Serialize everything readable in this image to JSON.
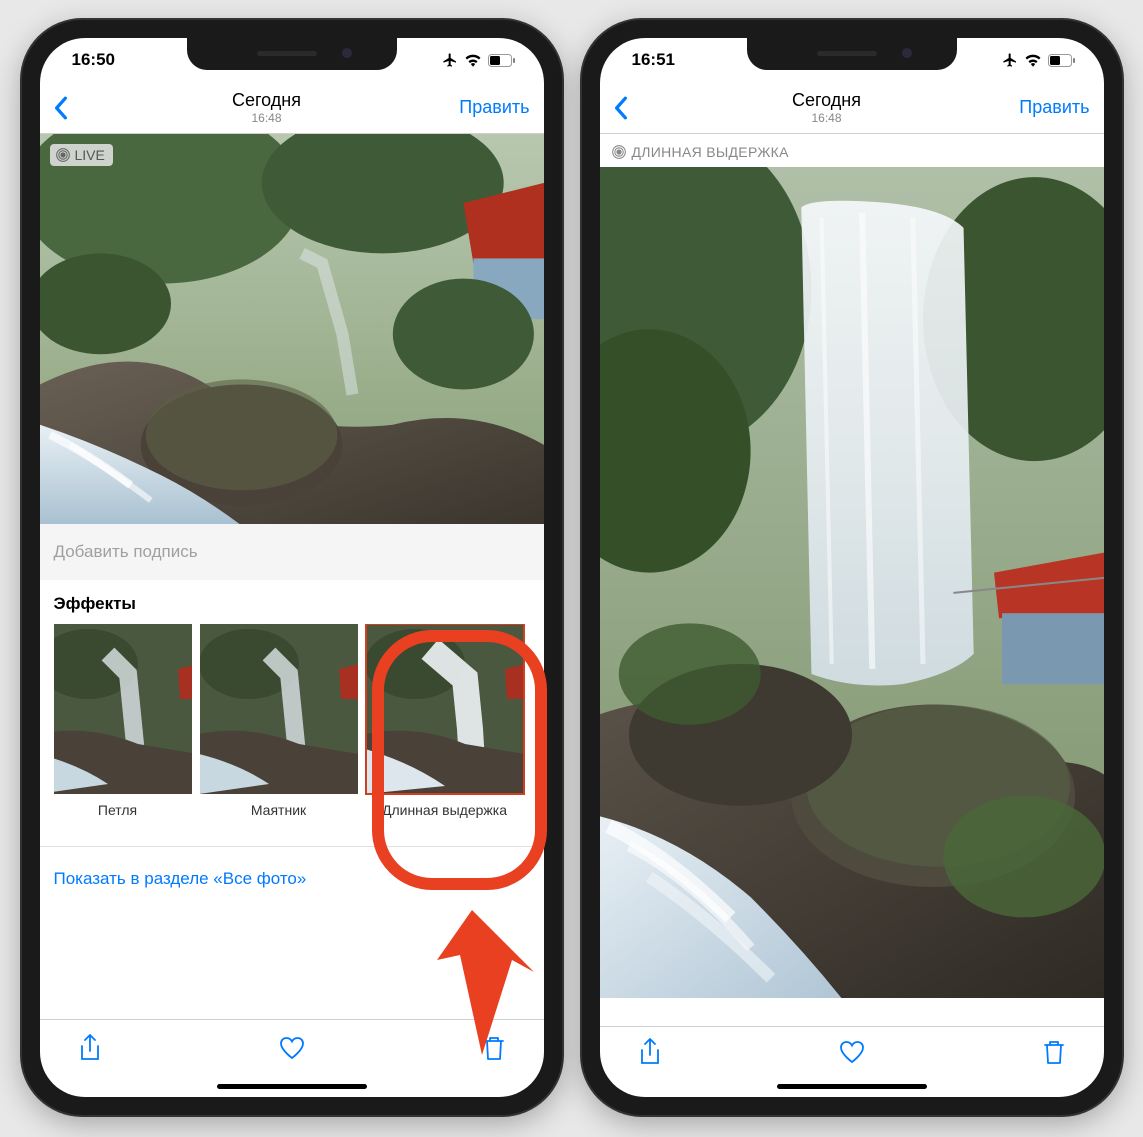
{
  "left": {
    "status_time": "16:50",
    "nav": {
      "title": "Сегодня",
      "subtitle": "16:48",
      "edit": "Править"
    },
    "live_badge": "LIVE",
    "caption_placeholder": "Добавить подпись",
    "effects_title": "Эффекты",
    "effects": [
      {
        "label": "Петля"
      },
      {
        "label": "Маятник"
      },
      {
        "label": "Длинная выдержка"
      }
    ],
    "show_all": "Показать в разделе «Все фото»"
  },
  "right": {
    "status_time": "16:51",
    "nav": {
      "title": "Сегодня",
      "subtitle": "16:48",
      "edit": "Править"
    },
    "badge": "ДЛИННАЯ ВЫДЕРЖКА"
  },
  "icons": {
    "back": "chevron-left",
    "share": "share",
    "heart": "heart",
    "trash": "trash",
    "airplane": "airplane",
    "wifi": "wifi",
    "battery": "battery"
  }
}
